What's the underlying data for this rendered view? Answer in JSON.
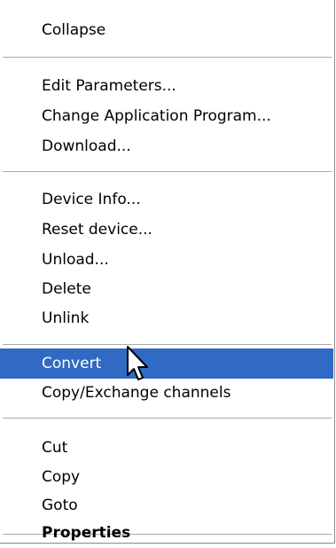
{
  "menu": {
    "items": [
      {
        "label": "Collapse"
      },
      {
        "label": "Edit Parameters..."
      },
      {
        "label": "Change Application Program..."
      },
      {
        "label": "Download..."
      },
      {
        "label": "Device Info..."
      },
      {
        "label": "Reset device..."
      },
      {
        "label": "Unload..."
      },
      {
        "label": "Delete"
      },
      {
        "label": "Unlink"
      },
      {
        "label": "Convert"
      },
      {
        "label": "Copy/Exchange channels"
      },
      {
        "label": "Cut"
      },
      {
        "label": "Copy"
      },
      {
        "label": "Goto"
      },
      {
        "label": "Properties"
      }
    ],
    "highlighted_item": "Convert",
    "colors": {
      "highlight": "#316ac5",
      "highlight_text": "#ffffff",
      "separator": "#a9a9a9"
    },
    "cursor_icon": "arrow-pointer-icon"
  }
}
